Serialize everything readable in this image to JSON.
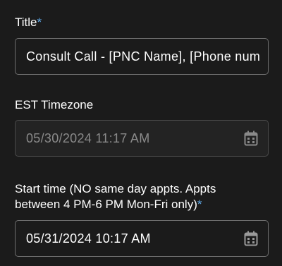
{
  "form": {
    "title_field": {
      "label": "Title",
      "required_mark": "*",
      "value": "Consult Call - [PNC Name], [Phone num"
    },
    "est_field": {
      "label": "EST Timezone",
      "value": "05/30/2024 11:17 AM",
      "icon": "calendar-icon"
    },
    "start_field": {
      "label_line1": "Start time (NO same day appts. Appts",
      "label_line2": "between 4 PM-6 PM Mon-Fri only)",
      "required_mark": "*",
      "value": "05/31/2024 10:17 AM",
      "icon": "calendar-icon"
    }
  },
  "colors": {
    "background": "#1b1b1b",
    "required_mark": "#5fa8e6",
    "border": "#6e6e6e",
    "disabled_text": "#8a8a8a"
  }
}
